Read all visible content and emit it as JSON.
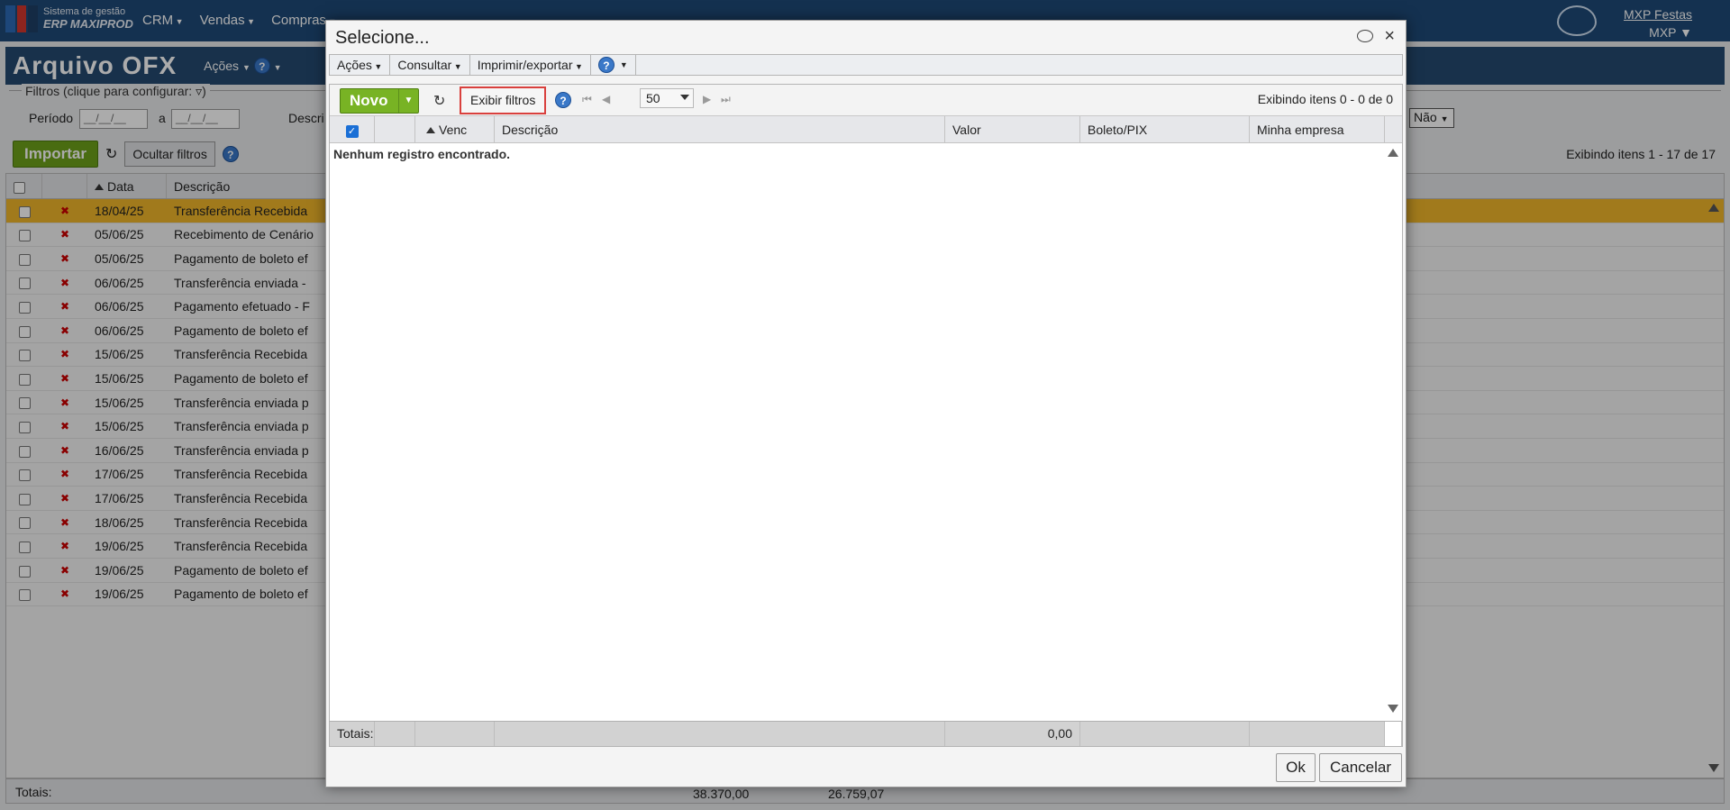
{
  "app": {
    "logo_line1": "Sistema de gestão",
    "logo_line2": "ERP MAXIPROD",
    "nav": [
      "CRM",
      "Vendas",
      "Compras"
    ],
    "company_link": "MXP Festas",
    "user": "MXP ▼"
  },
  "page": {
    "title": "Arquivo OFX",
    "actions_label": "Ações",
    "filters_legend": "Filtros (clique para configurar:",
    "period_label": "Período",
    "date_from_placeholder": "__/__/__",
    "date_to_placeholder": "__/__/__",
    "to_label": "a",
    "desc_label": "Descri",
    "nao_value": "Não",
    "import_label": "Importar",
    "hide_filters_label": "Ocultar filtros",
    "count_text": "Exibindo itens 1 - 17 de 17",
    "col_data": "Data",
    "col_desc": "Descrição",
    "rows": [
      {
        "date": "18/04/25",
        "desc": "Transferência Recebida"
      },
      {
        "date": "05/06/25",
        "desc": "Recebimento de Cenário"
      },
      {
        "date": "05/06/25",
        "desc": "Pagamento de boleto ef"
      },
      {
        "date": "06/06/25",
        "desc": "Transferência enviada -"
      },
      {
        "date": "06/06/25",
        "desc": "Pagamento efetuado - F"
      },
      {
        "date": "06/06/25",
        "desc": "Pagamento de boleto ef"
      },
      {
        "date": "15/06/25",
        "desc": "Transferência Recebida"
      },
      {
        "date": "15/06/25",
        "desc": "Pagamento de boleto ef"
      },
      {
        "date": "15/06/25",
        "desc": "Transferência enviada p"
      },
      {
        "date": "15/06/25",
        "desc": "Transferência enviada p"
      },
      {
        "date": "16/06/25",
        "desc": "Transferência enviada p"
      },
      {
        "date": "17/06/25",
        "desc": "Transferência Recebida"
      },
      {
        "date": "17/06/25",
        "desc": "Transferência Recebida"
      },
      {
        "date": "18/06/25",
        "desc": "Transferência Recebida"
      },
      {
        "date": "19/06/25",
        "desc": "Transferência Recebida"
      },
      {
        "date": "19/06/25",
        "desc": "Pagamento de boleto ef"
      },
      {
        "date": "19/06/25",
        "desc": "Pagamento de boleto ef"
      }
    ],
    "totals_label": "Totais:",
    "total_1": "38.370,00",
    "total_2": "26.759,07"
  },
  "modal": {
    "title": "Selecione...",
    "menu": {
      "acoes": "Ações",
      "consultar": "Consultar",
      "imprimir": "Imprimir/exportar"
    },
    "novo_label": "Novo",
    "show_filters_label": "Exibir filtros",
    "page_size": "50",
    "items_count": "Exibindo itens 0 - 0 de 0",
    "columns": {
      "venc": "Venc",
      "descricao": "Descrição",
      "valor": "Valor",
      "boleto": "Boleto/PIX",
      "empresa": "Minha empresa"
    },
    "empty_message": "Nenhum registro encontrado.",
    "totals_label": "Totais:",
    "totals_valor": "0,00",
    "ok_label": "Ok",
    "cancel_label": "Cancelar"
  },
  "colors": {
    "accent_green": "#78b324",
    "highlight_red": "#d9403d",
    "selected_row": "#f0b62a",
    "header_blue": "#244a70"
  }
}
